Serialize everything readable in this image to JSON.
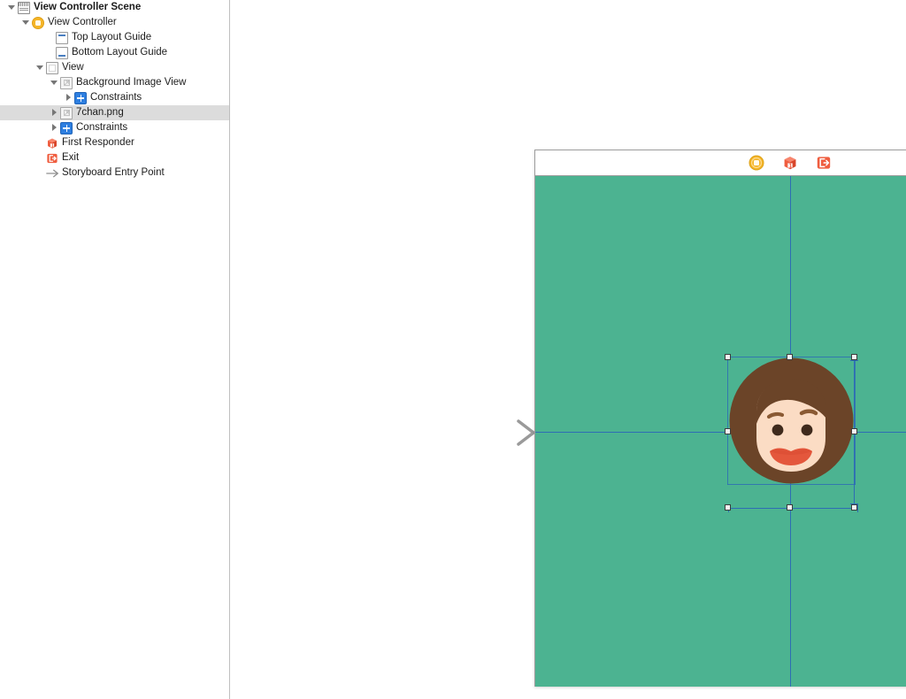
{
  "outline": {
    "panel_name": "Document Outline",
    "rows": [
      {
        "label": "View Controller Scene",
        "icon": "scene-icon",
        "indent": 8,
        "twisty": "open",
        "bold": true,
        "selected": false
      },
      {
        "label": "View Controller",
        "icon": "view-controller-icon",
        "indent": 24,
        "twisty": "open",
        "bold": false,
        "selected": false
      },
      {
        "label": "Top Layout Guide",
        "icon": "top-layout-guide-icon",
        "indent": 51,
        "twisty": "none",
        "bold": false,
        "selected": false
      },
      {
        "label": "Bottom Layout Guide",
        "icon": "bottom-layout-guide-icon",
        "indent": 51,
        "twisty": "none",
        "bold": false,
        "selected": false
      },
      {
        "label": "View",
        "icon": "view-icon",
        "indent": 40,
        "twisty": "open",
        "bold": false,
        "selected": false
      },
      {
        "label": "Background Image View",
        "icon": "image-view-icon",
        "indent": 56,
        "twisty": "open",
        "bold": false,
        "selected": false
      },
      {
        "label": "Constraints",
        "icon": "constraints-icon",
        "indent": 72,
        "twisty": "closed",
        "bold": false,
        "selected": false
      },
      {
        "label": "7chan.png",
        "icon": "image-view-icon",
        "indent": 56,
        "twisty": "closed",
        "bold": false,
        "selected": true
      },
      {
        "label": "Constraints",
        "icon": "constraints-icon",
        "indent": 56,
        "twisty": "closed",
        "bold": false,
        "selected": false
      },
      {
        "label": "First Responder",
        "icon": "first-responder-icon",
        "indent": 40,
        "twisty": "none",
        "bold": false,
        "selected": false
      },
      {
        "label": "Exit",
        "icon": "exit-icon",
        "indent": 40,
        "twisty": "none",
        "bold": false,
        "selected": false
      },
      {
        "label": "Storyboard Entry Point",
        "icon": "entry-point-arrow-icon",
        "indent": 40,
        "twisty": "none",
        "bold": false,
        "selected": false
      }
    ]
  },
  "canvas": {
    "name": "Interface Builder Canvas",
    "entry_point_label": "Storyboard Entry Point",
    "scene_dock": {
      "items": [
        {
          "name": "view-controller-dock-icon",
          "title": "View Controller"
        },
        {
          "name": "first-responder-dock-icon",
          "title": "First Responder"
        },
        {
          "name": "exit-dock-icon",
          "title": "Exit"
        }
      ]
    },
    "device": {
      "name": "root-view",
      "background_color": "#4cb391",
      "status_bar": {
        "battery_icon": "battery-icon"
      }
    },
    "selection": {
      "name": "7chan.png image view",
      "handles": 8,
      "guide_color": "#2e6db4",
      "handle_fill": "#f2f2f2",
      "handle_border": "#3c3c3c"
    },
    "avatar": {
      "name": "7chan.png",
      "hair_color": "#6b4428",
      "skin_color": "#fbdcc4",
      "eye_color": "#3f2a1c",
      "lips_color": "#e4573c",
      "brow_color": "#8a5a33"
    }
  },
  "colors": {
    "canvas_background": "#ffffff",
    "sidebar_background": "#ffffff",
    "selected_row": "#dcdcdc",
    "divider": "#bfbfbf",
    "accent_blue": "#2e7fe0",
    "accent_orange": "#f05a3c",
    "accent_yellow": "#f5b528",
    "device_teal": "#4cb391"
  }
}
